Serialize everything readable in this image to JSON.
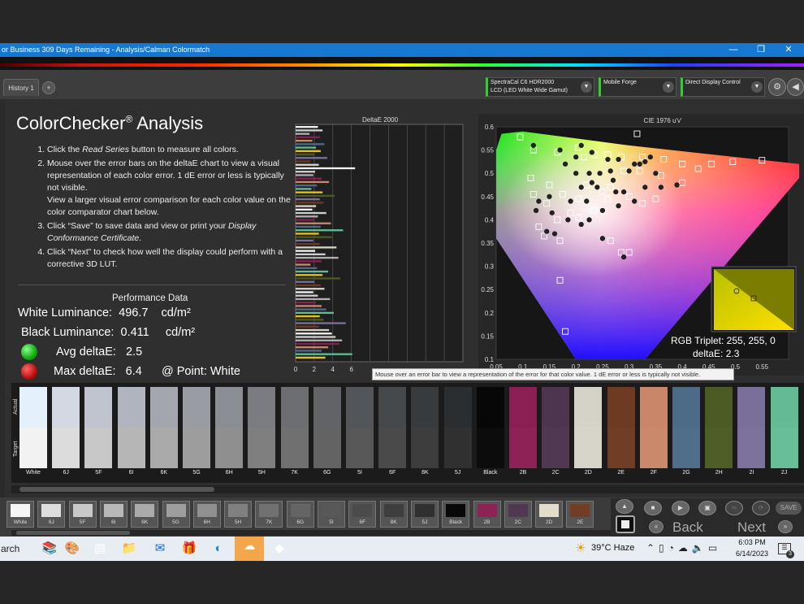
{
  "window": {
    "title": "or Business 309 Days Remaining  - Analysis/Calman Colormatch",
    "minimize": "—",
    "restore": "❐",
    "close": "✕"
  },
  "tabs": {
    "history": "History 1",
    "add": "+"
  },
  "devices": [
    {
      "line1": "SpectraCal C6 HDR2000",
      "line2": "LCD (LED White Wide Gamut)"
    },
    {
      "line1": "Mobile Forge",
      "line2": ""
    },
    {
      "line1": "Direct Display Control",
      "line2": ""
    }
  ],
  "toolbar_icons": [
    "gear-icon",
    "back-arrow-icon"
  ],
  "heading": {
    "main": "ColorChecker",
    "reg": "®",
    "rest": " Analysis"
  },
  "steps": [
    {
      "pre": "Click the ",
      "em": "Read Series",
      "post": " button to measure all colors."
    },
    {
      "pre": "Mouse over the error bars on the deltaE chart to view a visual representation of each color error. 1 dE error or less is typically not visible.",
      "em": "",
      "post": ""
    },
    {
      "pre": "Click “Save” to save data and view or print your ",
      "em": "Display Conformance Certificate",
      "post": "."
    },
    {
      "pre": "Click “Next” to check how well the display could perform with a corrective 3D LUT.",
      "em": "",
      "post": ""
    }
  ],
  "step2_extra": "View a larger visual error comparison for each color value on the color comparator chart below.",
  "performance": {
    "title": "Performance Data",
    "white_label": "White Luminance:",
    "white_value": "496.7",
    "white_unit": "cd/m²",
    "black_label": "Black Luminance:",
    "black_value": "0.411",
    "black_unit": "cd/m²",
    "avg_label": "Avg deltaE:",
    "avg_value": "2.5",
    "max_label": "Max deltaE:",
    "max_value": "6.4",
    "point_label": "@ Point: White",
    "colors": {
      "good": "#22bb22",
      "bad": "#cc1111"
    }
  },
  "chart_data": [
    {
      "type": "bar",
      "title": "DeltaE 2000",
      "orientation": "horizontal",
      "xticks": [
        "0",
        "2",
        "4",
        "6"
      ],
      "xlim": [
        0,
        18
      ],
      "values": [
        2.4,
        2.9,
        1.5,
        2.6,
        1.8,
        3.1,
        2.2,
        2.7,
        2.0,
        3.4,
        1.6,
        2.5,
        6.4,
        2.1,
        1.9,
        2.8,
        3.6,
        2.3,
        1.7,
        2.9,
        4.2,
        2.6,
        3.0,
        2.2,
        1.8,
        3.3,
        2.4,
        2.0,
        3.8,
        2.7,
        5.1,
        2.5,
        3.9,
        1.9,
        2.6,
        4.4,
        2.1,
        3.2,
        4.6,
        2.8,
        1.6,
        2.3,
        3.5,
        2.9,
        4.8,
        2.0,
        2.7,
        3.1,
        1.9,
        2.4,
        3.7,
        2.2,
        2.8,
        3.3,
        4.1,
        2.6,
        3.0,
        5.4,
        2.5,
        3.6,
        3.9,
        4.3,
        5.0,
        4.7,
        3.5,
        2.8,
        6.1,
        3.2
      ]
    },
    {
      "type": "scatter",
      "title": "CIE 1976 u'v'",
      "xticks": [
        "0.05",
        "0.1",
        "0.15",
        "0.2",
        "0.25",
        "0.3",
        "0.35",
        "0.4",
        "0.45",
        "0.5",
        "0.55"
      ],
      "yticks": [
        "0.1",
        "0.15",
        "0.2",
        "0.25",
        "0.3",
        "0.35",
        "0.4",
        "0.45",
        "0.5",
        "0.55",
        "0.6"
      ],
      "xlim": [
        0.05,
        0.6
      ],
      "ylim": [
        0.1,
        0.6
      ],
      "series": [
        {
          "name": "Target",
          "marker": "square",
          "points": [
            [
              0.095,
              0.578
            ],
            [
              0.12,
              0.55
            ],
            [
              0.165,
              0.545
            ],
            [
              0.205,
              0.555
            ],
            [
              0.215,
              0.535
            ],
            [
              0.235,
              0.54
            ],
            [
              0.26,
              0.54
            ],
            [
              0.285,
              0.535
            ],
            [
              0.325,
              0.535
            ],
            [
              0.365,
              0.53
            ],
            [
              0.4,
              0.52
            ],
            [
              0.43,
              0.51
            ],
            [
              0.455,
              0.52
            ],
            [
              0.495,
              0.525
            ],
            [
              0.55,
              0.528
            ],
            [
              0.29,
              0.505
            ],
            [
              0.32,
              0.505
            ],
            [
              0.36,
              0.495
            ],
            [
              0.115,
              0.49
            ],
            [
              0.15,
              0.475
            ],
            [
              0.175,
              0.455
            ],
            [
              0.205,
              0.445
            ],
            [
              0.22,
              0.475
            ],
            [
              0.25,
              0.46
            ],
            [
              0.26,
              0.445
            ],
            [
              0.3,
              0.45
            ],
            [
              0.325,
              0.435
            ],
            [
              0.35,
              0.445
            ],
            [
              0.12,
              0.455
            ],
            [
              0.145,
              0.435
            ],
            [
              0.165,
              0.4
            ],
            [
              0.19,
              0.415
            ],
            [
              0.205,
              0.405
            ],
            [
              0.235,
              0.42
            ],
            [
              0.13,
              0.385
            ],
            [
              0.14,
              0.365
            ],
            [
              0.17,
              0.355
            ],
            [
              0.265,
              0.355
            ],
            [
              0.285,
              0.33
            ],
            [
              0.3,
              0.33
            ],
            [
              0.4,
              0.48
            ],
            [
              0.17,
              0.27
            ],
            [
              0.18,
              0.16
            ],
            [
              0.315,
              0.585
            ],
            [
              0.265,
              0.47
            ]
          ]
        },
        {
          "name": "Actual",
          "marker": "circle",
          "points": [
            [
              0.12,
              0.56
            ],
            [
              0.17,
              0.55
            ],
            [
              0.21,
              0.56
            ],
            [
              0.23,
              0.545
            ],
            [
              0.26,
              0.53
            ],
            [
              0.28,
              0.53
            ],
            [
              0.31,
              0.52
            ],
            [
              0.32,
              0.52
            ],
            [
              0.33,
              0.525
            ],
            [
              0.34,
              0.535
            ],
            [
              0.35,
              0.5
            ],
            [
              0.2,
              0.5
            ],
            [
              0.225,
              0.5
            ],
            [
              0.245,
              0.5
            ],
            [
              0.21,
              0.47
            ],
            [
              0.23,
              0.48
            ],
            [
              0.19,
              0.44
            ],
            [
              0.22,
              0.44
            ],
            [
              0.25,
              0.42
            ],
            [
              0.275,
              0.46
            ],
            [
              0.28,
              0.43
            ],
            [
              0.31,
              0.44
            ],
            [
              0.13,
              0.44
            ],
            [
              0.155,
              0.415
            ],
            [
              0.185,
              0.4
            ],
            [
              0.21,
              0.39
            ],
            [
              0.225,
              0.4
            ],
            [
              0.145,
              0.375
            ],
            [
              0.16,
              0.37
            ],
            [
              0.25,
              0.36
            ],
            [
              0.29,
              0.32
            ],
            [
              0.125,
              0.42
            ],
            [
              0.15,
              0.45
            ],
            [
              0.265,
              0.505
            ],
            [
              0.3,
              0.505
            ],
            [
              0.2,
              0.535
            ],
            [
              0.18,
              0.52
            ],
            [
              0.24,
              0.47
            ],
            [
              0.27,
              0.485
            ],
            [
              0.29,
              0.46
            ],
            [
              0.33,
              0.47
            ],
            [
              0.36,
              0.47
            ],
            [
              0.39,
              0.475
            ]
          ]
        }
      ],
      "inset": {
        "rgb_triplet": "RGB Triplet: 255, 255, 0",
        "deltae": "deltaE: 2.3"
      }
    }
  ],
  "tooltip": "Mouse over an error bar to view a representation of the error for that color value. 1 dE error or less is typically not visible.",
  "swatch_axis": {
    "actual": "Actual",
    "target": "Target"
  },
  "swatches": [
    {
      "label": "White",
      "actual": "#e4f0fb",
      "target": "#f2f2f2"
    },
    {
      "label": "6J",
      "actual": "#d2d9e3",
      "target": "#dcdcdc"
    },
    {
      "label": "5F",
      "actual": "#bfc4cf",
      "target": "#c8c8c8"
    },
    {
      "label": "6I",
      "actual": "#b0b4be",
      "target": "#b6b6b6"
    },
    {
      "label": "6K",
      "actual": "#a3a6ae",
      "target": "#aaaaaa"
    },
    {
      "label": "5G",
      "actual": "#9a9ca3",
      "target": "#9d9d9d"
    },
    {
      "label": "6H",
      "actual": "#8b8d94",
      "target": "#8f8f8f"
    },
    {
      "label": "5H",
      "actual": "#7a7c82",
      "target": "#7f7f7f"
    },
    {
      "label": "7K",
      "actual": "#6c6e72",
      "target": "#707070"
    },
    {
      "label": "6G",
      "actual": "#616367",
      "target": "#636363"
    },
    {
      "label": "5I",
      "actual": "#52565a",
      "target": "#575757"
    },
    {
      "label": "6F",
      "actual": "#45494c",
      "target": "#4a4a4a"
    },
    {
      "label": "8K",
      "actual": "#383b3e",
      "target": "#3d3d3d"
    },
    {
      "label": "5J",
      "actual": "#2b2e30",
      "target": "#303030"
    },
    {
      "label": "Black",
      "actual": "#070708",
      "target": "#0c0c0c"
    },
    {
      "label": "2B",
      "actual": "#8a1f54",
      "target": "#8d2257"
    },
    {
      "label": "2C",
      "actual": "#4d3550",
      "target": "#503853"
    },
    {
      "label": "2D",
      "actual": "#d5d3c7",
      "target": "#d7d5c9"
    },
    {
      "label": "2E",
      "actual": "#6e3b22",
      "target": "#713e25"
    },
    {
      "label": "2F",
      "actual": "#c98669",
      "target": "#cb896b"
    },
    {
      "label": "2G",
      "actual": "#4d6a86",
      "target": "#506d89"
    },
    {
      "label": "2H",
      "actual": "#4c5a24",
      "target": "#4f5d27"
    },
    {
      "label": "2I",
      "actual": "#7a6f9a",
      "target": "#7d729d"
    },
    {
      "label": "2J",
      "actual": "#62bb92",
      "target": "#65be95"
    }
  ],
  "palette_strip": [
    {
      "label": "White",
      "color": "#f5f5f5"
    },
    {
      "label": "6J",
      "color": "#dddddd"
    },
    {
      "label": "5F",
      "color": "#c8c8c8"
    },
    {
      "label": "6I",
      "color": "#b8b8b8"
    },
    {
      "label": "6K",
      "color": "#aaaaaa"
    },
    {
      "label": "5G",
      "color": "#9e9e9e"
    },
    {
      "label": "6H",
      "color": "#909090"
    },
    {
      "label": "5H",
      "color": "#808080"
    },
    {
      "label": "7K",
      "color": "#717171"
    },
    {
      "label": "6G",
      "color": "#646464"
    },
    {
      "label": "5I",
      "color": "#585858"
    },
    {
      "label": "6F",
      "color": "#4b4b4b"
    },
    {
      "label": "8K",
      "color": "#3e3e3e"
    },
    {
      "label": "5J",
      "color": "#303030"
    },
    {
      "label": "Black",
      "color": "#080808"
    },
    {
      "label": "2B",
      "color": "#8d2257"
    },
    {
      "label": "2C",
      "color": "#503853"
    },
    {
      "label": "2D",
      "color": "#e2dccb"
    },
    {
      "label": "2E",
      "color": "#713e25"
    }
  ],
  "controls": {
    "save": "SAVE",
    "back": "Back",
    "next": "Next"
  },
  "taskbar": {
    "search": "arch",
    "weather": "39°C  Haze",
    "time": "6:03 PM",
    "date": "6/14/2023",
    "notifications": "3"
  }
}
